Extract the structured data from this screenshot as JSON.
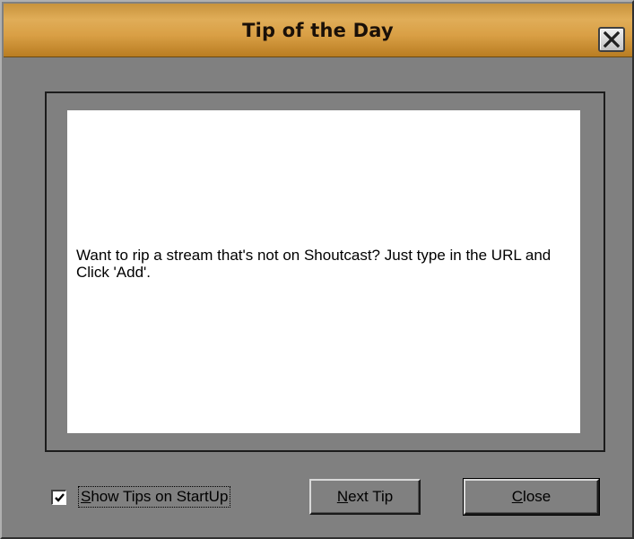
{
  "window": {
    "title": "Tip of the Day"
  },
  "tip": {
    "text": "Want to rip a stream that's not on Shoutcast? Just type in the URL and Click 'Add'."
  },
  "startup_checkbox": {
    "checked": true,
    "label_accel": "S",
    "label_rest": "how Tips on StartUp"
  },
  "buttons": {
    "next": {
      "accel": "N",
      "rest": "ext Tip"
    },
    "close": {
      "accel": "C",
      "rest": "lose"
    }
  },
  "icons": {
    "close": "close-x-icon",
    "check": "checkmark-icon"
  },
  "colors": {
    "titlebar_gradient": "#d99f45",
    "window_bg": "#808080",
    "panel_bg": "#ffffff"
  }
}
